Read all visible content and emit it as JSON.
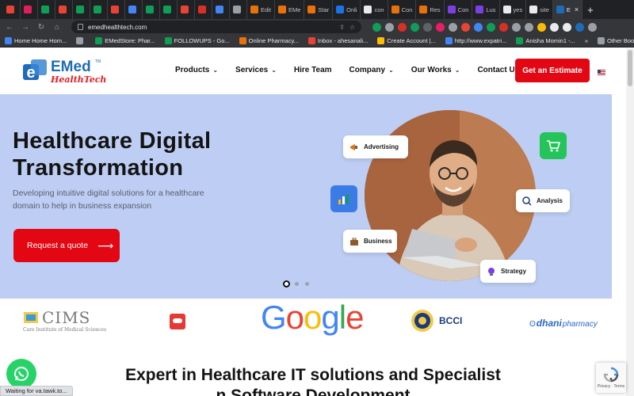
{
  "browser": {
    "tabs": [
      {
        "label": "",
        "color": "#ea4335"
      },
      {
        "label": "",
        "color": "#e01e5a"
      },
      {
        "label": "",
        "color": "#0f9d58"
      },
      {
        "label": "",
        "color": "#ea4335"
      },
      {
        "label": "",
        "color": "#0f9d58"
      },
      {
        "label": "",
        "color": "#0f9d58"
      },
      {
        "label": "",
        "color": "#ea4335"
      },
      {
        "label": "",
        "color": "#4285f4"
      },
      {
        "label": "",
        "color": "#0f9d58"
      },
      {
        "label": "",
        "color": "#0f9d58"
      },
      {
        "label": "",
        "color": "#ea4335"
      },
      {
        "label": "",
        "color": "#d93025"
      },
      {
        "label": "",
        "color": "#4285f4"
      },
      {
        "label": "",
        "color": "#9aa0a6"
      },
      {
        "label": "Edit",
        "color": "#e8710a"
      },
      {
        "label": "EMe",
        "color": "#e8710a"
      },
      {
        "label": "Star",
        "color": "#e8710a"
      },
      {
        "label": "Onli",
        "color": "#1a73e8"
      },
      {
        "label": "con",
        "color": "#e8eaed"
      },
      {
        "label": "Con",
        "color": "#e8710a"
      },
      {
        "label": "Res",
        "color": "#e8710a"
      },
      {
        "label": "Con",
        "color": "#7b3fe4"
      },
      {
        "label": "Lus",
        "color": "#7b3fe4"
      },
      {
        "label": "yes",
        "color": "#e8eaed"
      },
      {
        "label": "site",
        "color": "#e8eaed"
      },
      {
        "label": "E",
        "color": "#1e6bb8"
      }
    ],
    "new_tab_label": "+",
    "url": "emedhealthtech.com",
    "bookmarks": [
      {
        "label": "Home Home Hom...",
        "color": "#4285f4"
      },
      {
        "label": "",
        "color": "#9aa0a6"
      },
      {
        "label": "EMedStore: Phar...",
        "color": "#0f9d58"
      },
      {
        "label": "FOLLOWUPS - Go...",
        "color": "#0f9d58"
      },
      {
        "label": "Online Pharmacy...",
        "color": "#e8710a"
      },
      {
        "label": "Inbox - ahesanali...",
        "color": "#ea4335"
      },
      {
        "label": "Create Account |...",
        "color": "#fbbc04"
      },
      {
        "label": "http://www.expatri...",
        "color": "#4285f4"
      },
      {
        "label": "Anisha Momin1 -...",
        "color": "#0f9d58"
      }
    ],
    "bookmarks_more": "»",
    "other_bookmarks": "Other Bookmarks"
  },
  "site": {
    "logo": {
      "brand": "EMed",
      "tagline": "HealthTech",
      "tm": "TM"
    },
    "nav": [
      {
        "label": "Products",
        "has_dropdown": true
      },
      {
        "label": "Services",
        "has_dropdown": true
      },
      {
        "label": "Hire Team",
        "has_dropdown": false
      },
      {
        "label": "Company",
        "has_dropdown": true
      },
      {
        "label": "Our Works",
        "has_dropdown": true
      },
      {
        "label": "Contact Us",
        "has_dropdown": false
      }
    ],
    "cta_label": "Get an Estimate",
    "accent_color": "#e30613",
    "brand_blue": "#1e6bb8"
  },
  "hero": {
    "title_line1": "Healthcare Digital",
    "title_line2": "Transformation",
    "subtitle_line1": "Developing intuitive digital solutions for a healthcare",
    "subtitle_line2": "domain to help in business expansion",
    "button_label": "Request a quote",
    "cards": {
      "advertising": "Advertising",
      "analysis": "Analysis",
      "business": "Business",
      "strategy": "Strategy"
    },
    "background": "#bdcdf3",
    "slider": {
      "count": 3,
      "active": 0
    }
  },
  "clients": {
    "cims": {
      "name": "CIMS",
      "sub": "Care Institute of Medical Sciences"
    },
    "google": "Google",
    "bcci": "BCCI",
    "dhani": {
      "brand": "dhani",
      "suffix": "pharmacy"
    }
  },
  "section": {
    "heading_line1": "Expert in Healthcare IT solutions and Specialist",
    "heading_line2": "n Software Development"
  },
  "status_bar": "Waiting for va.tawk.to..."
}
